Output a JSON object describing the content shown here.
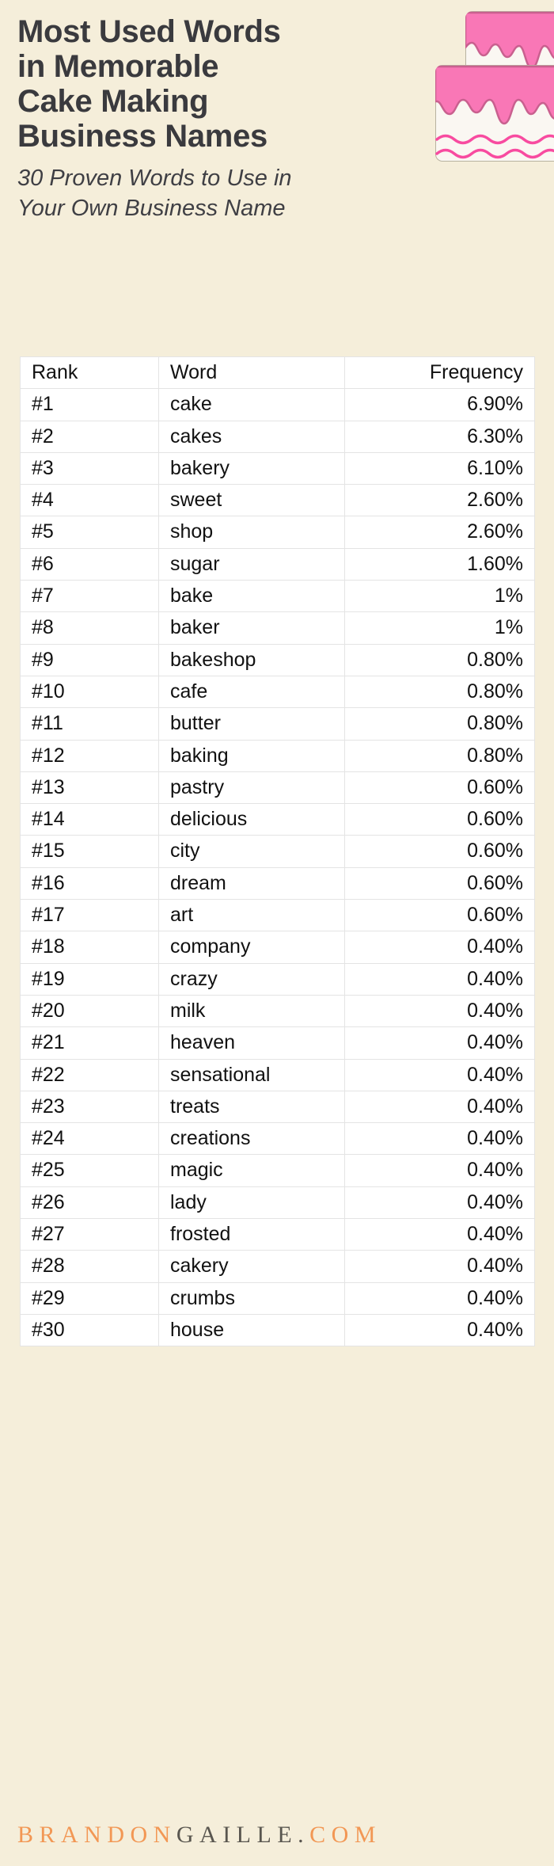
{
  "header": {
    "title_lines": [
      "Most Used Words",
      "in Memorable",
      "Cake Making",
      "Business Names"
    ],
    "title": "Most Used Words in Memorable Cake Making Business Names",
    "subtitle_lines": [
      "30 Proven Words to Use in",
      "Your Own Business Name"
    ],
    "subtitle": "30 Proven Words to Use in Your Own Business Name"
  },
  "illustration": {
    "name": "layered-cake-icon",
    "frosting_color": "#f977b6",
    "frosting_outline": "#c9608f",
    "cake_body_color": "#faf7f2",
    "cake_outline": "#b8b2a0",
    "drizzle_color": "#f84ba0"
  },
  "table": {
    "columns": [
      "Rank",
      "Word",
      "Frequency"
    ],
    "rows": [
      {
        "rank": "#1",
        "word": "cake",
        "frequency": "6.90%"
      },
      {
        "rank": "#2",
        "word": "cakes",
        "frequency": "6.30%"
      },
      {
        "rank": "#3",
        "word": "bakery",
        "frequency": "6.10%"
      },
      {
        "rank": "#4",
        "word": "sweet",
        "frequency": "2.60%"
      },
      {
        "rank": "#5",
        "word": "shop",
        "frequency": "2.60%"
      },
      {
        "rank": "#6",
        "word": "sugar",
        "frequency": "1.60%"
      },
      {
        "rank": "#7",
        "word": "bake",
        "frequency": "1%"
      },
      {
        "rank": "#8",
        "word": "baker",
        "frequency": "1%"
      },
      {
        "rank": "#9",
        "word": "bakeshop",
        "frequency": "0.80%"
      },
      {
        "rank": "#10",
        "word": "cafe",
        "frequency": "0.80%"
      },
      {
        "rank": "#11",
        "word": "butter",
        "frequency": "0.80%"
      },
      {
        "rank": "#12",
        "word": "baking",
        "frequency": "0.80%"
      },
      {
        "rank": "#13",
        "word": "pastry",
        "frequency": "0.60%"
      },
      {
        "rank": "#14",
        "word": "delicious",
        "frequency": "0.60%"
      },
      {
        "rank": "#15",
        "word": "city",
        "frequency": "0.60%"
      },
      {
        "rank": "#16",
        "word": "dream",
        "frequency": "0.60%"
      },
      {
        "rank": "#17",
        "word": "art",
        "frequency": "0.60%"
      },
      {
        "rank": "#18",
        "word": "company",
        "frequency": "0.40%"
      },
      {
        "rank": "#19",
        "word": "crazy",
        "frequency": "0.40%"
      },
      {
        "rank": "#20",
        "word": "milk",
        "frequency": "0.40%"
      },
      {
        "rank": "#21",
        "word": "heaven",
        "frequency": "0.40%"
      },
      {
        "rank": "#22",
        "word": "sensational",
        "frequency": "0.40%"
      },
      {
        "rank": "#23",
        "word": "treats",
        "frequency": "0.40%"
      },
      {
        "rank": "#24",
        "word": "creations",
        "frequency": "0.40%"
      },
      {
        "rank": "#25",
        "word": "magic",
        "frequency": "0.40%"
      },
      {
        "rank": "#26",
        "word": "lady",
        "frequency": "0.40%"
      },
      {
        "rank": "#27",
        "word": "frosted",
        "frequency": "0.40%"
      },
      {
        "rank": "#28",
        "word": "cakery",
        "frequency": "0.40%"
      },
      {
        "rank": "#29",
        "word": "crumbs",
        "frequency": "0.40%"
      },
      {
        "rank": "#30",
        "word": "house",
        "frequency": "0.40%"
      }
    ]
  },
  "footer": {
    "brand_part1": "BRANDON",
    "brand_part2": "GAILLE.",
    "brand_part3": "COM",
    "brand_full": "BRANDONGAILLE.COM",
    "accent_color": "#f29754",
    "dark_color": "#59564f"
  },
  "chart_data": {
    "type": "table",
    "title": "Most Used Words in Memorable Cake Making Business Names",
    "subtitle": "30 Proven Words to Use in Your Own Business Name",
    "xlabel": "Word",
    "ylabel": "Frequency",
    "categories": [
      "cake",
      "cakes",
      "bakery",
      "sweet",
      "shop",
      "sugar",
      "bake",
      "baker",
      "bakeshop",
      "cafe",
      "butter",
      "baking",
      "pastry",
      "delicious",
      "city",
      "dream",
      "art",
      "company",
      "crazy",
      "milk",
      "heaven",
      "sensational",
      "treats",
      "creations",
      "magic",
      "lady",
      "frosted",
      "cakery",
      "crumbs",
      "house"
    ],
    "values": [
      6.9,
      6.3,
      6.1,
      2.6,
      2.6,
      1.6,
      1.0,
      1.0,
      0.8,
      0.8,
      0.8,
      0.8,
      0.6,
      0.6,
      0.6,
      0.6,
      0.6,
      0.4,
      0.4,
      0.4,
      0.4,
      0.4,
      0.4,
      0.4,
      0.4,
      0.4,
      0.4,
      0.4,
      0.4,
      0.4
    ],
    "ranks": [
      "#1",
      "#2",
      "#3",
      "#4",
      "#5",
      "#6",
      "#7",
      "#8",
      "#9",
      "#10",
      "#11",
      "#12",
      "#13",
      "#14",
      "#15",
      "#16",
      "#17",
      "#18",
      "#19",
      "#20",
      "#21",
      "#22",
      "#23",
      "#24",
      "#25",
      "#26",
      "#27",
      "#28",
      "#29",
      "#30"
    ],
    "value_labels": [
      "6.90%",
      "6.30%",
      "6.10%",
      "2.60%",
      "2.60%",
      "1.60%",
      "1%",
      "1%",
      "0.80%",
      "0.80%",
      "0.80%",
      "0.80%",
      "0.60%",
      "0.60%",
      "0.60%",
      "0.60%",
      "0.60%",
      "0.40%",
      "0.40%",
      "0.40%",
      "0.40%",
      "0.40%",
      "0.40%",
      "0.40%",
      "0.40%",
      "0.40%",
      "0.40%",
      "0.40%",
      "0.40%",
      "0.40%"
    ],
    "unit": "percent",
    "grid": true,
    "legend": false
  }
}
